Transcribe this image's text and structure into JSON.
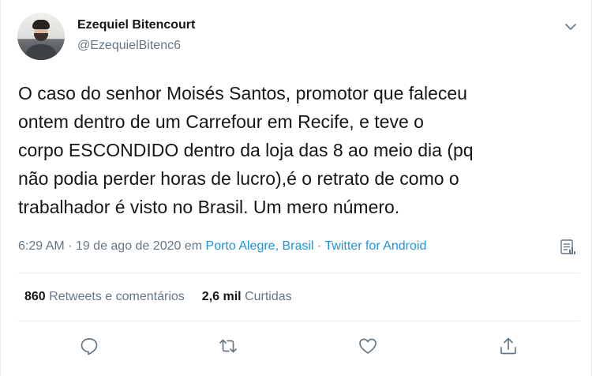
{
  "author": {
    "name": "Ezequiel Bitencourt",
    "handle": "@EzequielBitenc6"
  },
  "tweet": {
    "text": "O caso do senhor Moisés Santos, promotor que faleceu\nontem dentro de um Carrefour em Recife, e teve o\ncorpo ESCONDIDO dentro da loja das 8 ao meio dia (pq\nnão podia perder horas de lucro),é o retrato de como o\ntrabalhador é visto no Brasil. Um mero número."
  },
  "meta": {
    "time": "6:29 AM",
    "sep1": " · ",
    "date": "19 de ago de 2020",
    "in": " em ",
    "location": "Porto Alegre, Brasil",
    "sep2": " · ",
    "source": "Twitter for Android"
  },
  "stats": {
    "retweets_count": "860",
    "retweets_label": "Retweets e comentários",
    "likes_count": "2,6 mil",
    "likes_label": "Curtidas"
  },
  "icons": {
    "caret": "chevron-down-icon",
    "analytics": "analytics-icon",
    "reply": "reply-icon",
    "retweet": "retweet-icon",
    "like": "heart-icon",
    "share": "share-icon"
  },
  "colors": {
    "text": "#14171a",
    "secondary": "#657786",
    "link": "#1b95e0",
    "divider": "#e6ecf0"
  }
}
